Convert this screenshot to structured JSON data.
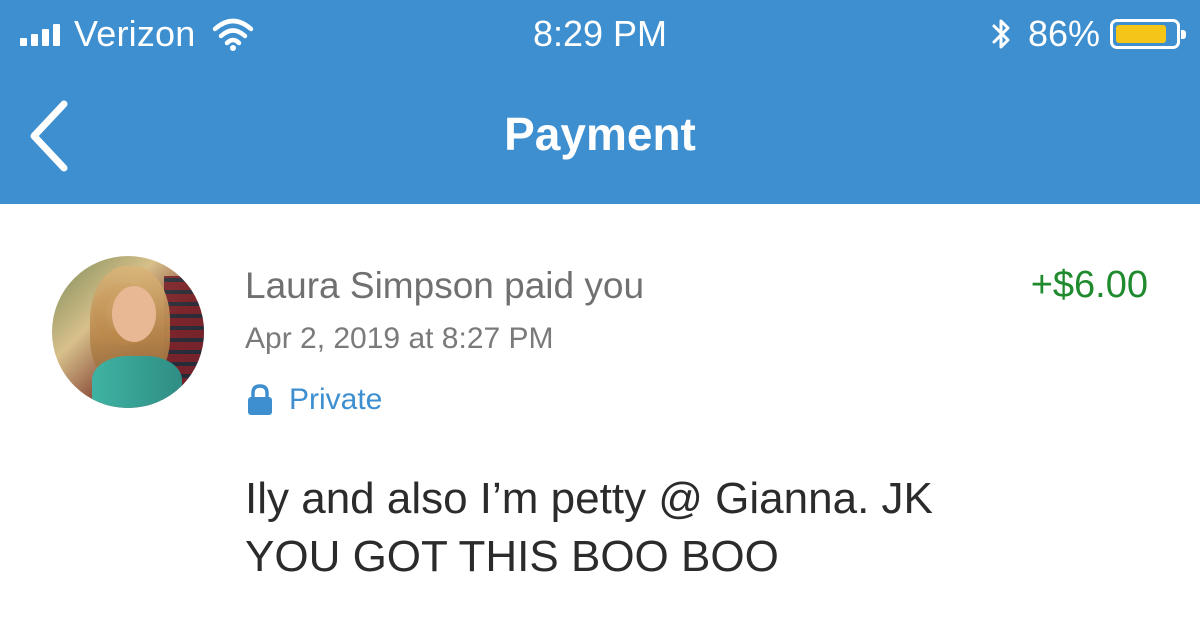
{
  "status_bar": {
    "carrier": "Verizon",
    "time": "8:29 PM",
    "battery_percent": "86%",
    "battery_level": 0.86,
    "signal_icon": "signal-bars-icon",
    "wifi_icon": "wifi-icon",
    "bluetooth_icon": "bluetooth-icon"
  },
  "nav": {
    "title": "Payment",
    "back_icon": "chevron-left-icon"
  },
  "transaction": {
    "payer_text": "Laura Simpson paid you",
    "date": "Apr 2, 2019 at 8:27 PM",
    "privacy_icon": "lock-icon",
    "privacy": "Private",
    "amount": "+$6.00",
    "note_lines": [
      "Ily and also I’m petty @ Gianna. JK",
      "YOU GOT THIS BOO BOO"
    ]
  },
  "colors": {
    "header_blue": "#3d8fd0",
    "amount_green": "#1f8a2e",
    "private_blue": "#3d8fd0",
    "battery_yellow": "#f5c518"
  }
}
